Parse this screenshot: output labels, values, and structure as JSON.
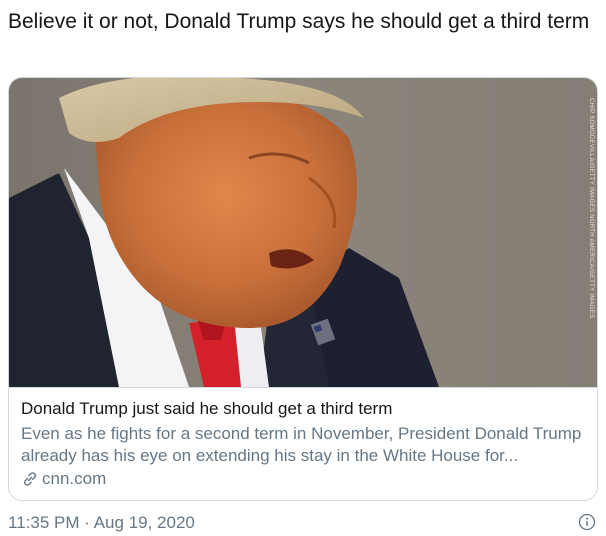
{
  "tweet": {
    "text": "Believe it or not, Donald Trump says he should get a third term"
  },
  "card": {
    "image_alt": "photo",
    "photo_credit_icon": "vertical-photo-credit",
    "title": "Donald Trump just said he should get a third term",
    "description": "Even as he fights for a second term in November, President Donald Trump already has his eye on extending his stay in the White House for...",
    "domain": "cnn.com",
    "domain_icon": "link-icon"
  },
  "footer": {
    "time": "11:35 PM",
    "separator": "·",
    "date": "Aug 19, 2020",
    "info_icon": "info-icon"
  },
  "colors": {
    "text_primary": "#14171a",
    "text_secondary": "#657786",
    "border": "#cfd9de"
  }
}
